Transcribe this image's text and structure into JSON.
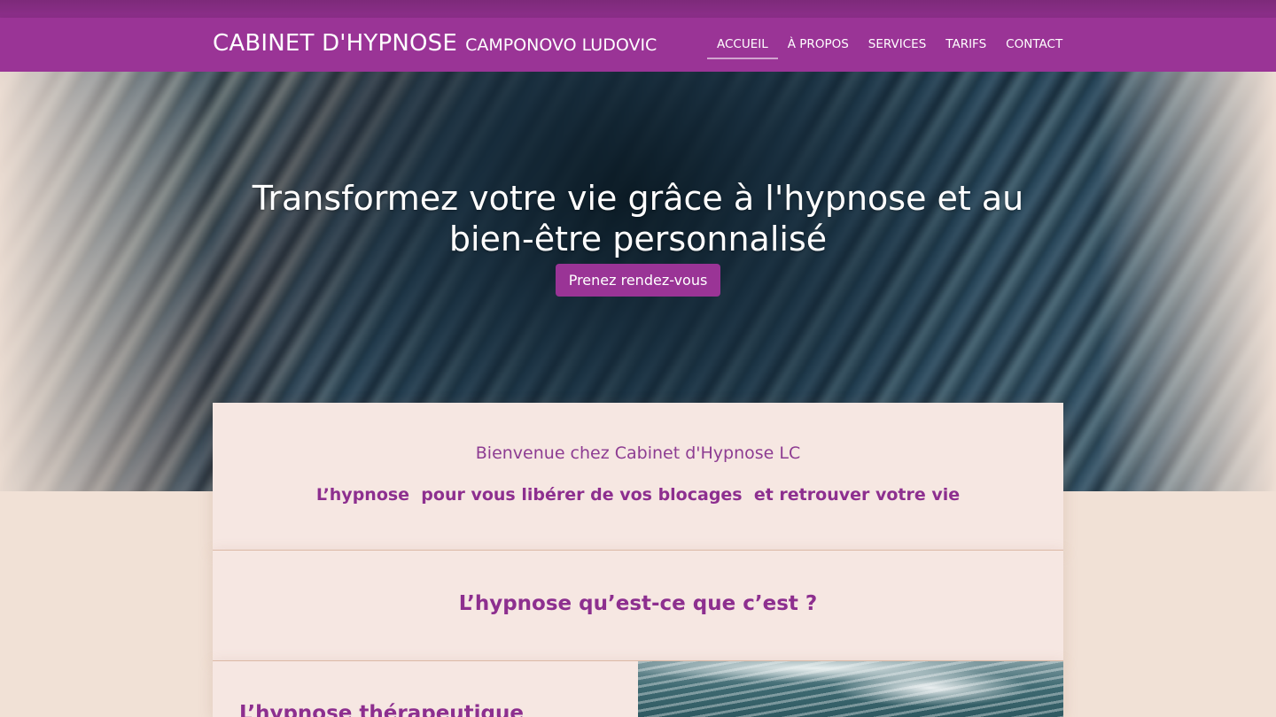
{
  "header": {
    "brand_main": "CABINET D'HYPNOSE",
    "brand_sub": "CAMPONOVO LUDOVIC",
    "nav": [
      {
        "label": "ACCUEIL",
        "active": true
      },
      {
        "label": "À PROPOS",
        "active": false
      },
      {
        "label": "SERVICES",
        "active": false
      },
      {
        "label": "TARIFS",
        "active": false
      },
      {
        "label": "CONTACT",
        "active": false
      }
    ]
  },
  "hero": {
    "title_line1": "Transformez votre vie grâce à l'hypnose et au",
    "title_line2": "bien-être personnalisé",
    "cta_label": "Prenez rendez-vous"
  },
  "welcome": {
    "heading": "Bienvenue chez Cabinet d'Hypnose LC",
    "tagline": "L’hypnose  pour vous libérer de vos blocages  et retrouver votre vie"
  },
  "intro": {
    "title_bold": "L’hypnose",
    "title_rest": " qu’est-ce que c’est ?"
  },
  "therapeutic": {
    "title_bold": "L’hypnose",
    "title_rest": " thérapeutique"
  },
  "colors": {
    "brand_purple": "#9a3496",
    "text_purple": "#8d2f8f",
    "background": "#f1e1d6",
    "card": "#f6e7e2"
  }
}
